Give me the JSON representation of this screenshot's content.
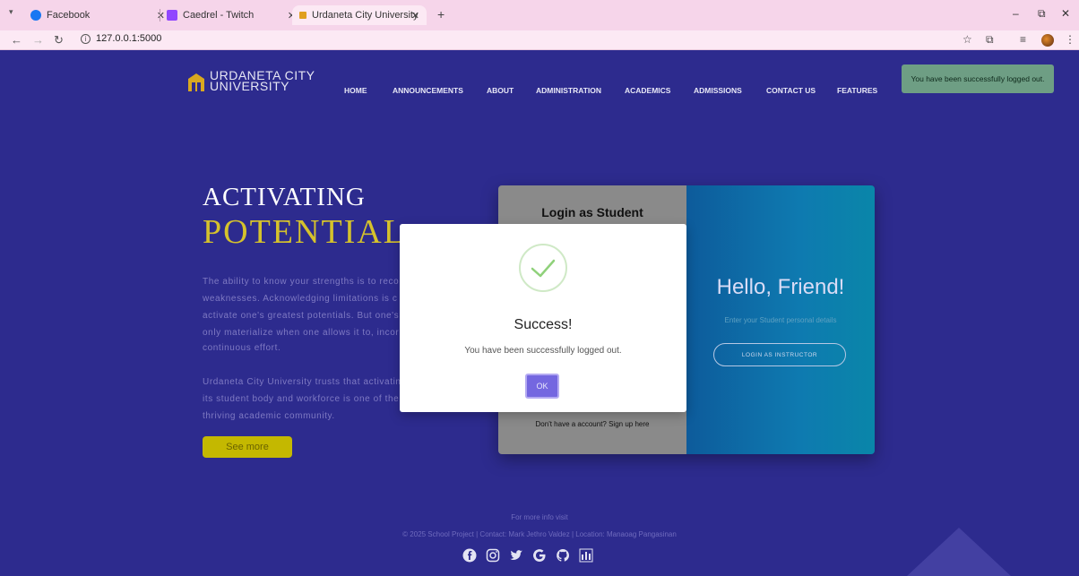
{
  "browser": {
    "tabs": [
      {
        "title": "Facebook",
        "icon": "facebook-icon"
      },
      {
        "title": "Caedrel - Twitch",
        "icon": "twitch-icon"
      },
      {
        "title": "Urdaneta City University",
        "icon": "site-icon"
      }
    ],
    "url": "127.0.0.1:5000"
  },
  "site": {
    "logo_line1": "URDANETA CITY",
    "logo_line2": "UNIVERSITY",
    "menu": [
      "HOME",
      "ANNOUNCEMENTS",
      "ABOUT",
      "ADMINISTRATION",
      "ACADEMICS",
      "ADMISSIONS",
      "CONTACT US",
      "FEATURES"
    ]
  },
  "toast": "You have been successfully logged out.",
  "hero": {
    "line1": "ACTIVATING",
    "line2": "POTENTIAL",
    "p1": [
      "The ability to know your strengths is to reco",
      "weaknesses. Acknowledging limitations is c",
      "activate one's greatest potentials. But one's",
      "only materialize when one allows it to, incor",
      "continuous effort."
    ],
    "p2": [
      "Urdaneta City University trusts that activatin",
      "its student body and workforce is one of the",
      "thriving academic community."
    ],
    "button": "See more"
  },
  "login": {
    "title": "Login as Student",
    "signup": "Don't have a account? Sign up here",
    "hello": "Hello, Friend!",
    "hello_sub": "Enter your Student personal details",
    "instructor_button": "LOGIN AS INSTRUCTOR"
  },
  "modal": {
    "title": "Success!",
    "text": "You have been successfully logged out.",
    "ok": "OK"
  },
  "footer": {
    "line1": "For more info visit",
    "line2": "© 2025 School Project | Contact: Mark Jethro Valdez | Location: Manaoag Pangasinan",
    "socials": [
      "facebook-icon",
      "instagram-icon",
      "twitter-icon",
      "google-icon",
      "github-icon",
      "stats-icon"
    ]
  }
}
